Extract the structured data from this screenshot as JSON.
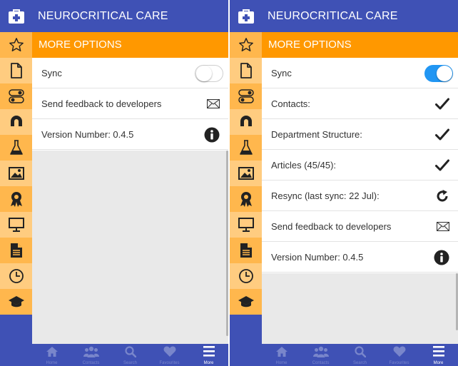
{
  "app": {
    "title": "NEUROCRITICAL CARE",
    "section_title": "MORE OPTIONS"
  },
  "sidebar_icons": [
    "star-icon",
    "document-icon",
    "toggles-icon",
    "magnet-icon",
    "flask-icon",
    "picture-icon",
    "award-icon",
    "monitor-icon",
    "file-text-icon",
    "clock-icon",
    "graduation-cap-icon"
  ],
  "bottom_nav": [
    {
      "label": "Home",
      "icon": "home-icon"
    },
    {
      "label": "Contacts",
      "icon": "people-icon"
    },
    {
      "label": "Search",
      "icon": "search-icon"
    },
    {
      "label": "Favourites",
      "icon": "heart-icon"
    },
    {
      "label": "More",
      "icon": "menu-icon"
    }
  ],
  "screen1": {
    "sync_label": "Sync",
    "sync_on": false,
    "feedback_label": "Send feedback to developers",
    "version_label": "Version Number: 0.4.5"
  },
  "screen2": {
    "sync_label": "Sync",
    "sync_on": true,
    "contacts_label": "Contacts:",
    "department_label": "Department Structure:",
    "articles_label": "Articles (45/45):",
    "resync_label": "Resync (last sync: 22 Jul):",
    "feedback_label": "Send feedback to developers",
    "version_label": "Version Number: 0.4.5"
  },
  "colors": {
    "primary": "#3f51b5",
    "sidebar_tile_a": "#ffb74d",
    "sidebar_tile_b": "#ffcc80",
    "accent": "#ff9800",
    "toggle_on": "#2196f3"
  }
}
